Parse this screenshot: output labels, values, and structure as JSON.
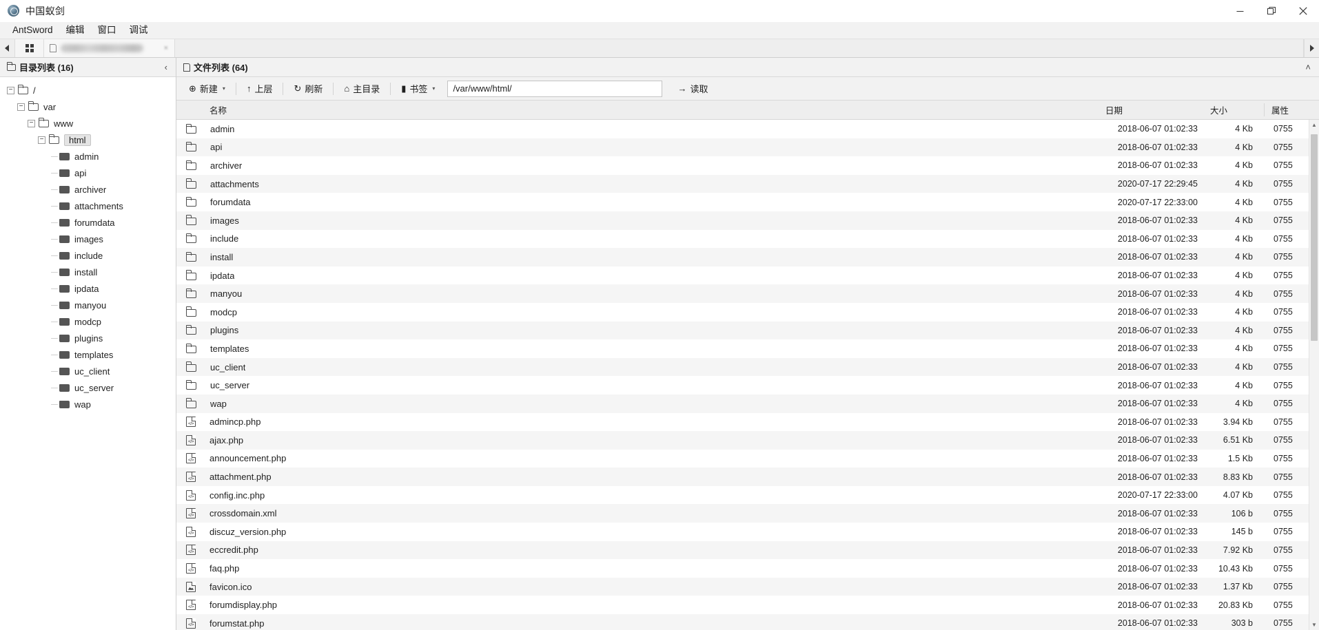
{
  "window": {
    "title": "中国蚁剑",
    "app_icon": "antsword-logo-icon",
    "minimize": "—",
    "maximize": "restore-icon",
    "close": "✕"
  },
  "menubar": {
    "items": [
      {
        "label": "AntSword",
        "name": "menu-antsword"
      },
      {
        "label": "编辑",
        "name": "menu-edit"
      },
      {
        "label": "窗口",
        "name": "menu-window"
      },
      {
        "label": "调试",
        "name": "menu-debug"
      }
    ]
  },
  "tabstrip": {
    "prev_arrow": "◂",
    "next_arrow": "▸",
    "grid_label": "grid-view-icon",
    "tab_close": "×"
  },
  "left_panel": {
    "title": "目录列表 (16)",
    "collapse": "‹",
    "tree": [
      {
        "label": "/",
        "depth": 0,
        "expander": "−",
        "icon": "folder-open-icon",
        "selected": false
      },
      {
        "label": "var",
        "depth": 1,
        "expander": "−",
        "icon": "folder-open-icon",
        "selected": false
      },
      {
        "label": "www",
        "depth": 2,
        "expander": "−",
        "icon": "folder-open-icon",
        "selected": false
      },
      {
        "label": "html",
        "depth": 3,
        "expander": "−",
        "icon": "folder-open-icon",
        "selected": true
      },
      {
        "label": "admin",
        "depth": 4,
        "expander": "",
        "icon": "folder-solid-icon",
        "selected": false
      },
      {
        "label": "api",
        "depth": 4,
        "expander": "",
        "icon": "folder-solid-icon",
        "selected": false
      },
      {
        "label": "archiver",
        "depth": 4,
        "expander": "",
        "icon": "folder-solid-icon",
        "selected": false
      },
      {
        "label": "attachments",
        "depth": 4,
        "expander": "",
        "icon": "folder-solid-icon",
        "selected": false
      },
      {
        "label": "forumdata",
        "depth": 4,
        "expander": "",
        "icon": "folder-solid-icon",
        "selected": false
      },
      {
        "label": "images",
        "depth": 4,
        "expander": "",
        "icon": "folder-solid-icon",
        "selected": false
      },
      {
        "label": "include",
        "depth": 4,
        "expander": "",
        "icon": "folder-solid-icon",
        "selected": false
      },
      {
        "label": "install",
        "depth": 4,
        "expander": "",
        "icon": "folder-solid-icon",
        "selected": false
      },
      {
        "label": "ipdata",
        "depth": 4,
        "expander": "",
        "icon": "folder-solid-icon",
        "selected": false
      },
      {
        "label": "manyou",
        "depth": 4,
        "expander": "",
        "icon": "folder-solid-icon",
        "selected": false
      },
      {
        "label": "modcp",
        "depth": 4,
        "expander": "",
        "icon": "folder-solid-icon",
        "selected": false
      },
      {
        "label": "plugins",
        "depth": 4,
        "expander": "",
        "icon": "folder-solid-icon",
        "selected": false
      },
      {
        "label": "templates",
        "depth": 4,
        "expander": "",
        "icon": "folder-solid-icon",
        "selected": false
      },
      {
        "label": "uc_client",
        "depth": 4,
        "expander": "",
        "icon": "folder-solid-icon",
        "selected": false
      },
      {
        "label": "uc_server",
        "depth": 4,
        "expander": "",
        "icon": "folder-solid-icon",
        "selected": false
      },
      {
        "label": "wap",
        "depth": 4,
        "expander": "",
        "icon": "folder-solid-icon",
        "selected": false
      }
    ]
  },
  "right_panel": {
    "title": "文件列表 (64)",
    "collapse": "˄",
    "toolbar": {
      "new_label": "新建",
      "new_icon": "⊕",
      "up_label": "上层",
      "up_icon": "↑",
      "refresh_label": "刷新",
      "refresh_icon": "↻",
      "home_label": "主目录",
      "home_icon": "⌂",
      "bookmark_label": "书签",
      "bookmark_icon": "▮",
      "caret": "▾",
      "path_value": "/var/www/html/",
      "path_placeholder": "/var/www/html/",
      "read_label": "读取",
      "read_icon": "→"
    },
    "columns": {
      "name": "名称",
      "date": "日期",
      "size": "大小",
      "attr": "属性"
    },
    "files": [
      {
        "name": "admin",
        "icon": "folder",
        "date": "2018-06-07 01:02:33",
        "size": "4 Kb",
        "attr": "0755"
      },
      {
        "name": "api",
        "icon": "folder",
        "date": "2018-06-07 01:02:33",
        "size": "4 Kb",
        "attr": "0755"
      },
      {
        "name": "archiver",
        "icon": "folder",
        "date": "2018-06-07 01:02:33",
        "size": "4 Kb",
        "attr": "0755"
      },
      {
        "name": "attachments",
        "icon": "folder",
        "date": "2020-07-17 22:29:45",
        "size": "4 Kb",
        "attr": "0755"
      },
      {
        "name": "forumdata",
        "icon": "folder",
        "date": "2020-07-17 22:33:00",
        "size": "4 Kb",
        "attr": "0755"
      },
      {
        "name": "images",
        "icon": "folder",
        "date": "2018-06-07 01:02:33",
        "size": "4 Kb",
        "attr": "0755"
      },
      {
        "name": "include",
        "icon": "folder",
        "date": "2018-06-07 01:02:33",
        "size": "4 Kb",
        "attr": "0755"
      },
      {
        "name": "install",
        "icon": "folder",
        "date": "2018-06-07 01:02:33",
        "size": "4 Kb",
        "attr": "0755"
      },
      {
        "name": "ipdata",
        "icon": "folder",
        "date": "2018-06-07 01:02:33",
        "size": "4 Kb",
        "attr": "0755"
      },
      {
        "name": "manyou",
        "icon": "folder",
        "date": "2018-06-07 01:02:33",
        "size": "4 Kb",
        "attr": "0755"
      },
      {
        "name": "modcp",
        "icon": "folder",
        "date": "2018-06-07 01:02:33",
        "size": "4 Kb",
        "attr": "0755"
      },
      {
        "name": "plugins",
        "icon": "folder",
        "date": "2018-06-07 01:02:33",
        "size": "4 Kb",
        "attr": "0755"
      },
      {
        "name": "templates",
        "icon": "folder",
        "date": "2018-06-07 01:02:33",
        "size": "4 Kb",
        "attr": "0755"
      },
      {
        "name": "uc_client",
        "icon": "folder",
        "date": "2018-06-07 01:02:33",
        "size": "4 Kb",
        "attr": "0755"
      },
      {
        "name": "uc_server",
        "icon": "folder",
        "date": "2018-06-07 01:02:33",
        "size": "4 Kb",
        "attr": "0755"
      },
      {
        "name": "wap",
        "icon": "folder",
        "date": "2018-06-07 01:02:33",
        "size": "4 Kb",
        "attr": "0755"
      },
      {
        "name": "admincp.php",
        "icon": "code",
        "date": "2018-06-07 01:02:33",
        "size": "3.94 Kb",
        "attr": "0755"
      },
      {
        "name": "ajax.php",
        "icon": "code",
        "date": "2018-06-07 01:02:33",
        "size": "6.51 Kb",
        "attr": "0755"
      },
      {
        "name": "announcement.php",
        "icon": "code",
        "date": "2018-06-07 01:02:33",
        "size": "1.5 Kb",
        "attr": "0755"
      },
      {
        "name": "attachment.php",
        "icon": "code",
        "date": "2018-06-07 01:02:33",
        "size": "8.83 Kb",
        "attr": "0755"
      },
      {
        "name": "config.inc.php",
        "icon": "code",
        "date": "2020-07-17 22:33:00",
        "size": "4.07 Kb",
        "attr": "0755"
      },
      {
        "name": "crossdomain.xml",
        "icon": "code",
        "date": "2018-06-07 01:02:33",
        "size": "106 b",
        "attr": "0755"
      },
      {
        "name": "discuz_version.php",
        "icon": "code",
        "date": "2018-06-07 01:02:33",
        "size": "145 b",
        "attr": "0755"
      },
      {
        "name": "eccredit.php",
        "icon": "code",
        "date": "2018-06-07 01:02:33",
        "size": "7.92 Kb",
        "attr": "0755"
      },
      {
        "name": "faq.php",
        "icon": "code",
        "date": "2018-06-07 01:02:33",
        "size": "10.43 Kb",
        "attr": "0755"
      },
      {
        "name": "favicon.ico",
        "icon": "image",
        "date": "2018-06-07 01:02:33",
        "size": "1.37 Kb",
        "attr": "0755"
      },
      {
        "name": "forumdisplay.php",
        "icon": "code",
        "date": "2018-06-07 01:02:33",
        "size": "20.83 Kb",
        "attr": "0755"
      },
      {
        "name": "forumstat.php",
        "icon": "code",
        "date": "2018-06-07 01:02:33",
        "size": "303 b",
        "attr": "0755"
      }
    ],
    "scrollbar": {
      "up": "▲",
      "down": "▼"
    }
  }
}
